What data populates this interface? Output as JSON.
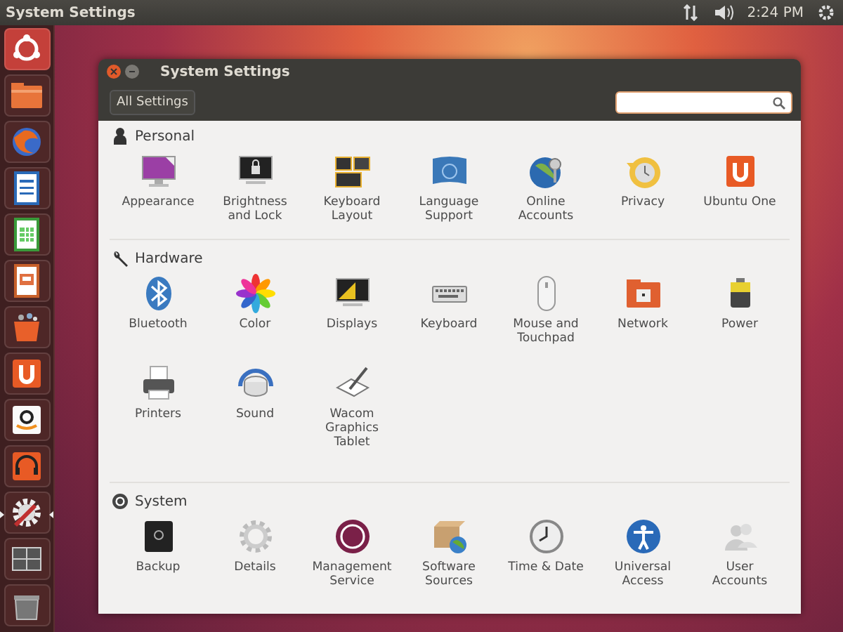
{
  "top_panel": {
    "title": "System Settings",
    "clock": "2:24 PM"
  },
  "launcher": [
    {
      "kind": "dash",
      "active": false
    },
    {
      "kind": "files",
      "active": false
    },
    {
      "kind": "browser",
      "active": false
    },
    {
      "kind": "writer",
      "active": false
    },
    {
      "kind": "calc",
      "active": false
    },
    {
      "kind": "impress",
      "active": false
    },
    {
      "kind": "store",
      "active": false
    },
    {
      "kind": "ubuntuone",
      "active": false
    },
    {
      "kind": "amazon",
      "active": false
    },
    {
      "kind": "music",
      "active": false
    },
    {
      "kind": "settings",
      "active": true
    },
    {
      "kind": "workspaces",
      "active": false
    },
    {
      "kind": "trash",
      "active": false
    }
  ],
  "window": {
    "title": "System Settings",
    "all_settings_button": "All Settings"
  },
  "sections": [
    {
      "name": "Personal",
      "kind": "person",
      "items": [
        {
          "label": "Appearance",
          "kind": "appearance"
        },
        {
          "label": "Brightness and Lock",
          "kind": "lock"
        },
        {
          "label": "Keyboard Layout",
          "kind": "layout"
        },
        {
          "label": "Language Support",
          "kind": "flag"
        },
        {
          "label": "Online Accounts",
          "kind": "globe"
        },
        {
          "label": "Privacy",
          "kind": "privacy"
        },
        {
          "label": "Ubuntu One",
          "kind": "ubuntuone"
        }
      ]
    },
    {
      "name": "Hardware",
      "kind": "wrench",
      "items": [
        {
          "label": "Bluetooth",
          "kind": "bluetooth"
        },
        {
          "label": "Color",
          "kind": "color"
        },
        {
          "label": "Displays",
          "kind": "display"
        },
        {
          "label": "Keyboard",
          "kind": "keyboard"
        },
        {
          "label": "Mouse and Touchpad",
          "kind": "mouse"
        },
        {
          "label": "Network",
          "kind": "network"
        },
        {
          "label": "Power",
          "kind": "power"
        },
        {
          "label": "Printers",
          "kind": "printer"
        },
        {
          "label": "Sound",
          "kind": "sound"
        },
        {
          "label": "Wacom Graphics Tablet",
          "kind": "tablet"
        }
      ]
    },
    {
      "name": "System",
      "kind": "ubuntu",
      "items": [
        {
          "label": "Backup",
          "kind": "backup"
        },
        {
          "label": "Details",
          "kind": "gear"
        },
        {
          "label": "Management Service",
          "kind": "landscape"
        },
        {
          "label": "Software Sources",
          "kind": "box"
        },
        {
          "label": "Time & Date",
          "kind": "clock"
        },
        {
          "label": "Universal Access",
          "kind": "access"
        },
        {
          "label": "User Accounts",
          "kind": "users"
        }
      ]
    }
  ]
}
